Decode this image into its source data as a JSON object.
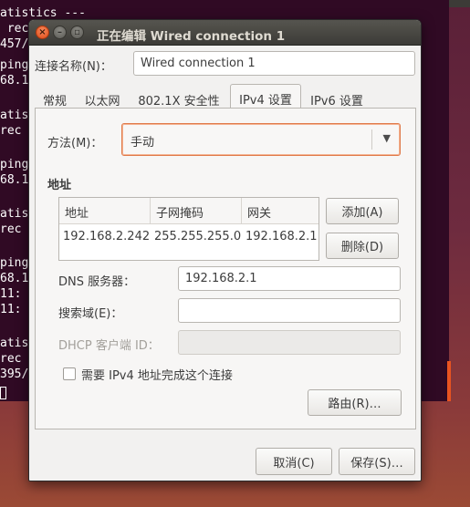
{
  "terminal": {
    "lines": [
      "atistics ---",
      " rec",
      "457/",
      "ping",
      "68.1",
      "",
      "atis",
      "rec",
      "",
      "ping",
      "68.1",
      "",
      "atis",
      "rec",
      "",
      "ping",
      "68.1",
      "11:",
      "11:",
      "",
      "atis",
      "rec",
      "395/"
    ]
  },
  "window": {
    "title": "正在编辑 Wired connection 1",
    "close_glyph": "×",
    "min_glyph": "–",
    "max_glyph": "▫"
  },
  "connection": {
    "name_label": "连接名称(N)：",
    "name_value": "Wired connection 1"
  },
  "tabs": [
    {
      "label": "常规",
      "active": false
    },
    {
      "label": "以太网",
      "active": false
    },
    {
      "label": "802.1X 安全性",
      "active": false
    },
    {
      "label": "IPv4 设置",
      "active": true
    },
    {
      "label": "IPv6 设置",
      "active": false
    }
  ],
  "ipv4": {
    "method_label": "方法(M)：",
    "method_value": "手动",
    "dropdown_icon": "chevron-down-icon",
    "dropdown_glyph": "▼",
    "address_heading": "地址",
    "table": {
      "columns": [
        "地址",
        "子网掩码",
        "网关"
      ],
      "rows": [
        [
          "192.168.2.242",
          "255.255.255.0",
          "192.168.2.1"
        ]
      ]
    },
    "add_button": "添加(A)",
    "delete_button": "删除(D)",
    "dns_label": "DNS 服务器：",
    "dns_value": "192.168.2.1",
    "search_label": "搜索域(E)：",
    "search_value": "",
    "dhcp_label": "DHCP 客户端 ID：",
    "dhcp_value": "",
    "require_ipv4_label": "需要 IPv4 地址完成这个连接",
    "require_ipv4_checked": false,
    "routes_button": "路由(R)…"
  },
  "footer": {
    "cancel_button": "取消(C)",
    "save_button": "保存(S)…"
  },
  "colors": {
    "accent": "#e95420",
    "terminal_bg": "#300a24",
    "titlebar": "#3c3b37",
    "dialog_bg": "#f2f1f0"
  }
}
